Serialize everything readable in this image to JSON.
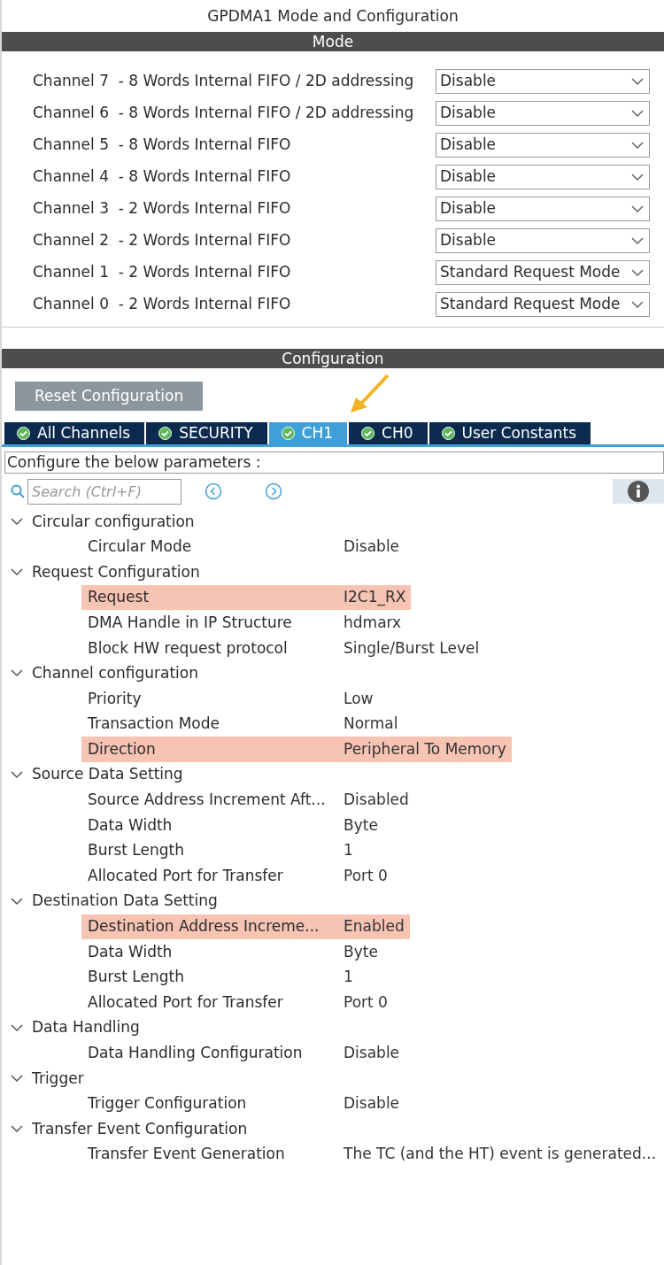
{
  "window": {
    "title": "GPDMA1 Mode and Configuration"
  },
  "mode": {
    "title": "Mode",
    "channels": [
      {
        "label": "Channel 7  - 8 Words Internal FIFO / 2D addressing",
        "value": "Disable"
      },
      {
        "label": "Channel 6  - 8 Words Internal FIFO / 2D addressing",
        "value": "Disable"
      },
      {
        "label": "Channel 5  - 8 Words Internal FIFO",
        "value": "Disable"
      },
      {
        "label": "Channel 4  - 8 Words Internal FIFO",
        "value": "Disable"
      },
      {
        "label": "Channel 3  - 2 Words Internal FIFO",
        "value": "Disable"
      },
      {
        "label": "Channel 2  - 2 Words Internal FIFO",
        "value": "Disable"
      },
      {
        "label": "Channel 1  - 2 Words Internal FIFO",
        "value": "Standard Request Mode"
      },
      {
        "label": "Channel 0  - 2 Words Internal FIFO",
        "value": "Standard Request Mode"
      }
    ]
  },
  "configuration": {
    "title": "Configuration",
    "reset_button": "Reset Configuration",
    "tabs": [
      {
        "label": "All Channels",
        "selected": false
      },
      {
        "label": "SECURITY",
        "selected": false
      },
      {
        "label": "CH1",
        "selected": true
      },
      {
        "label": "CH0",
        "selected": false
      },
      {
        "label": "User Constants",
        "selected": false
      }
    ],
    "hint": "Configure the below parameters :",
    "search": {
      "placeholder": "Search (Ctrl+F)"
    },
    "tree": [
      {
        "label": "Circular configuration",
        "expanded": true,
        "children": [
          {
            "label": "Circular Mode",
            "value": "Disable",
            "highlighted": false
          }
        ]
      },
      {
        "label": "Request Configuration",
        "expanded": true,
        "children": [
          {
            "label": "Request",
            "value": "I2C1_RX",
            "highlighted": true
          },
          {
            "label": "DMA Handle in IP Structure",
            "value": "hdmarx",
            "highlighted": false
          },
          {
            "label": "Block HW request protocol",
            "value": "Single/Burst Level",
            "highlighted": false
          }
        ]
      },
      {
        "label": "Channel configuration",
        "expanded": true,
        "children": [
          {
            "label": "Priority",
            "value": "Low",
            "highlighted": false
          },
          {
            "label": "Transaction Mode",
            "value": "Normal",
            "highlighted": false
          },
          {
            "label": "Direction",
            "value": "Peripheral To Memory",
            "highlighted": true
          }
        ]
      },
      {
        "label": "Source Data Setting",
        "expanded": true,
        "children": [
          {
            "label": "Source Address Increment Aft...",
            "value": "Disabled",
            "highlighted": false
          },
          {
            "label": "Data Width",
            "value": "Byte",
            "highlighted": false
          },
          {
            "label": "Burst Length",
            "value": "1",
            "highlighted": false
          },
          {
            "label": "Allocated Port for Transfer",
            "value": "Port 0",
            "highlighted": false
          }
        ]
      },
      {
        "label": "Destination Data Setting",
        "expanded": true,
        "children": [
          {
            "label": "Destination Address Increme...",
            "value": "Enabled",
            "highlighted": true
          },
          {
            "label": "Data Width",
            "value": "Byte",
            "highlighted": false
          },
          {
            "label": "Burst Length",
            "value": "1",
            "highlighted": false
          },
          {
            "label": "Allocated Port for Transfer",
            "value": "Port 0",
            "highlighted": false
          }
        ]
      },
      {
        "label": "Data Handling",
        "expanded": true,
        "children": [
          {
            "label": "Data Handling Configuration",
            "value": "Disable",
            "highlighted": false
          }
        ]
      },
      {
        "label": "Trigger",
        "expanded": true,
        "children": [
          {
            "label": "Trigger Configuration",
            "value": "Disable",
            "highlighted": false
          }
        ]
      },
      {
        "label": "Transfer Event Configuration",
        "expanded": true,
        "children": [
          {
            "label": "Transfer Event Generation",
            "value": "The TC (and the HT) event is generated...",
            "highlighted": false
          }
        ]
      }
    ]
  }
}
